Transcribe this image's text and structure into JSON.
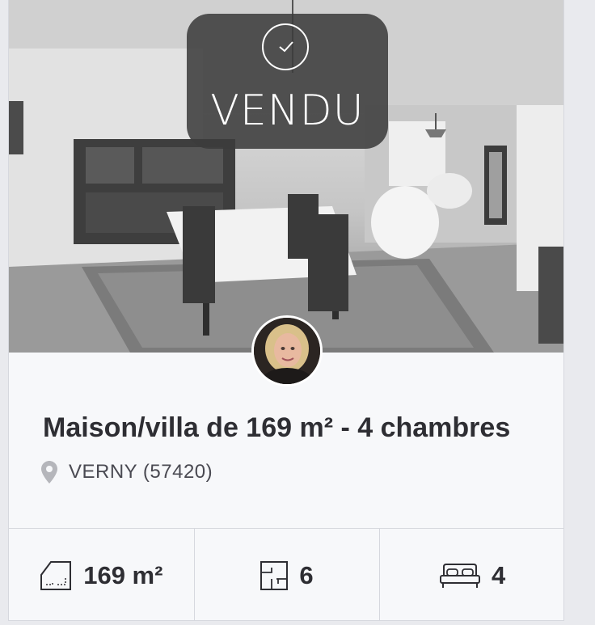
{
  "listing": {
    "status_badge": "VENDU",
    "title": "Maison/villa de 169 m² - 4 chambres",
    "location": "VERNY (57420)"
  },
  "features": {
    "surface": "169 m²",
    "rooms": "6",
    "bedrooms": "4"
  },
  "icons": {
    "status": "check-circle-icon",
    "location": "map-pin-icon",
    "surface": "floor-area-icon",
    "rooms": "floor-plan-icon",
    "bedrooms": "bed-icon"
  },
  "colors": {
    "title_text": "#2e2e33",
    "badge_bg": "#3c3c3c",
    "card_bg": "#f7f8fa",
    "border": "#d6d8de"
  }
}
